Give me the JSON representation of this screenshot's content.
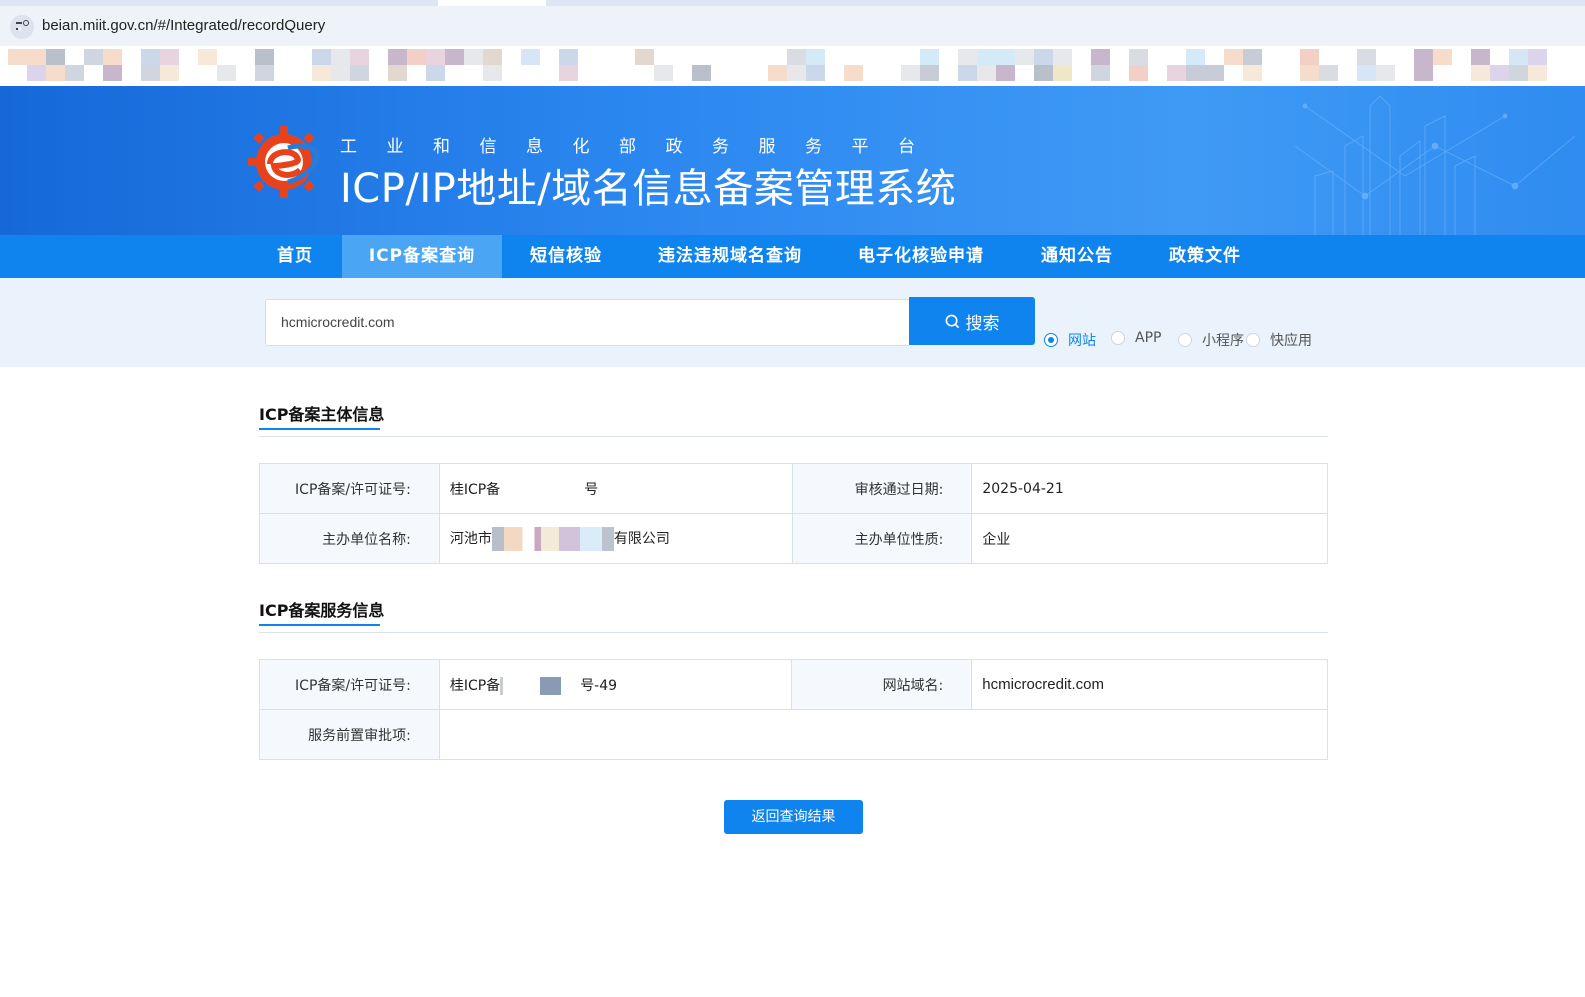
{
  "browser": {
    "url": "beian.miit.gov.cn/#/Integrated/recordQuery"
  },
  "header": {
    "subtitle": "工业和信息化部政务服务平台",
    "title": "ICP/IP地址/域名信息备案管理系统"
  },
  "nav": {
    "items": [
      "首页",
      "ICP备案查询",
      "短信核验",
      "违法违规域名查询",
      "电子化核验申请",
      "通知公告",
      "政策文件"
    ],
    "active": "ICP备案查询"
  },
  "search": {
    "value": "hcmicrocredit.com",
    "button_label": "搜索",
    "types": [
      {
        "label": "网站",
        "checked": true
      },
      {
        "label": "APP",
        "checked": false
      },
      {
        "label": "小程序",
        "checked": false
      },
      {
        "label": "快应用",
        "checked": false
      }
    ]
  },
  "subject_info": {
    "title": "ICP备案主体信息",
    "license_label": "ICP备案/许可证号:",
    "license_prefix": "桂ICP备",
    "license_suffix": "号",
    "approve_date_label": "审核通过日期:",
    "approve_date": "2025-04-21",
    "org_name_label": "主办单位名称:",
    "org_name_prefix": "河池市",
    "org_name_suffix": "有限公司",
    "org_type_label": "主办单位性质:",
    "org_type": "企业"
  },
  "service_info": {
    "title": "ICP备案服务信息",
    "license_label": "ICP备案/许可证号:",
    "license_prefix": "桂ICP备",
    "license_suffix": "号-49",
    "domain_label": "网站域名:",
    "domain": "hcmicrocredit.com",
    "preapproval_label": "服务前置审批项:",
    "preapproval": ""
  },
  "actions": {
    "back_label": "返回查询结果"
  },
  "colors": {
    "primary": "#0f84ee",
    "header_blue": "#2b87f0",
    "search_band": "#eaf3fb"
  }
}
